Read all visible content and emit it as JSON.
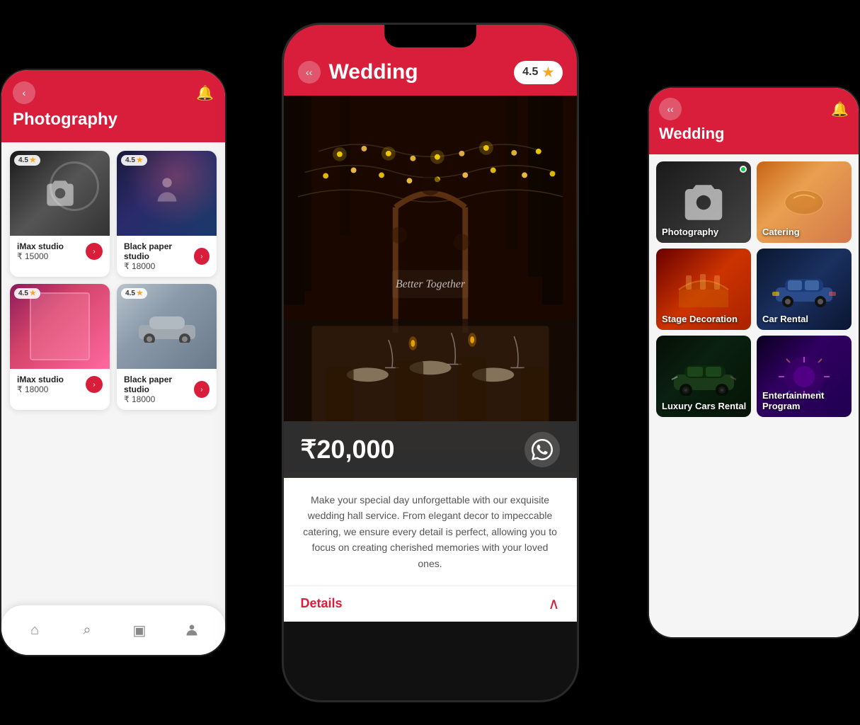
{
  "leftPhone": {
    "backLabel": "‹",
    "bellLabel": "🔔",
    "title": "Photography",
    "cards": [
      {
        "name": "iMax studio",
        "price": "₹ 15000",
        "rating": "4.5",
        "imgType": "camera"
      },
      {
        "name": "Black paper studio",
        "price": "₹ 18000",
        "rating": "4.5",
        "imgType": "photographer"
      },
      {
        "name": "iMax studio",
        "price": "₹ 18000",
        "rating": "4.5",
        "imgType": "pink-room"
      },
      {
        "name": "Black paper studio",
        "price": "₹ 18000",
        "rating": "4.5",
        "imgType": "car"
      }
    ],
    "nav": {
      "home": "⌂",
      "search": "⌕",
      "bookings": "▣",
      "profile": "👤"
    }
  },
  "centerPhone": {
    "backLabel": "‹",
    "title": "Wedding",
    "rating": "4.5",
    "starIcon": "★",
    "price": "₹20,000",
    "whatsappIcon": "💬",
    "weddingSign": "Better Together",
    "description": "Make your special day unforgettable with our exquisite wedding hall service. From elegant decor to impeccable catering, we ensure every detail is perfect, allowing you to focus on creating cherished memories with your loved ones.",
    "detailsLabel": "Details",
    "chevronUpIcon": "∧"
  },
  "rightPhone": {
    "backLabel": "‹",
    "bellLabel": "🔔",
    "title": "Wedding",
    "services": [
      {
        "label": "Photography",
        "imgType": "photography-r",
        "hasDot": true
      },
      {
        "label": "Catering",
        "imgType": "catering",
        "hasDot": false
      },
      {
        "label": "Stage Decoration",
        "imgType": "stage",
        "hasDot": false
      },
      {
        "label": "Car Rental",
        "imgType": "car-rental",
        "hasDot": false
      },
      {
        "label": "Luxury Cars Rental",
        "imgType": "luxury-car",
        "hasDot": false
      },
      {
        "label": "Entertainment Program",
        "imgType": "entertainment",
        "hasDot": false
      }
    ]
  }
}
